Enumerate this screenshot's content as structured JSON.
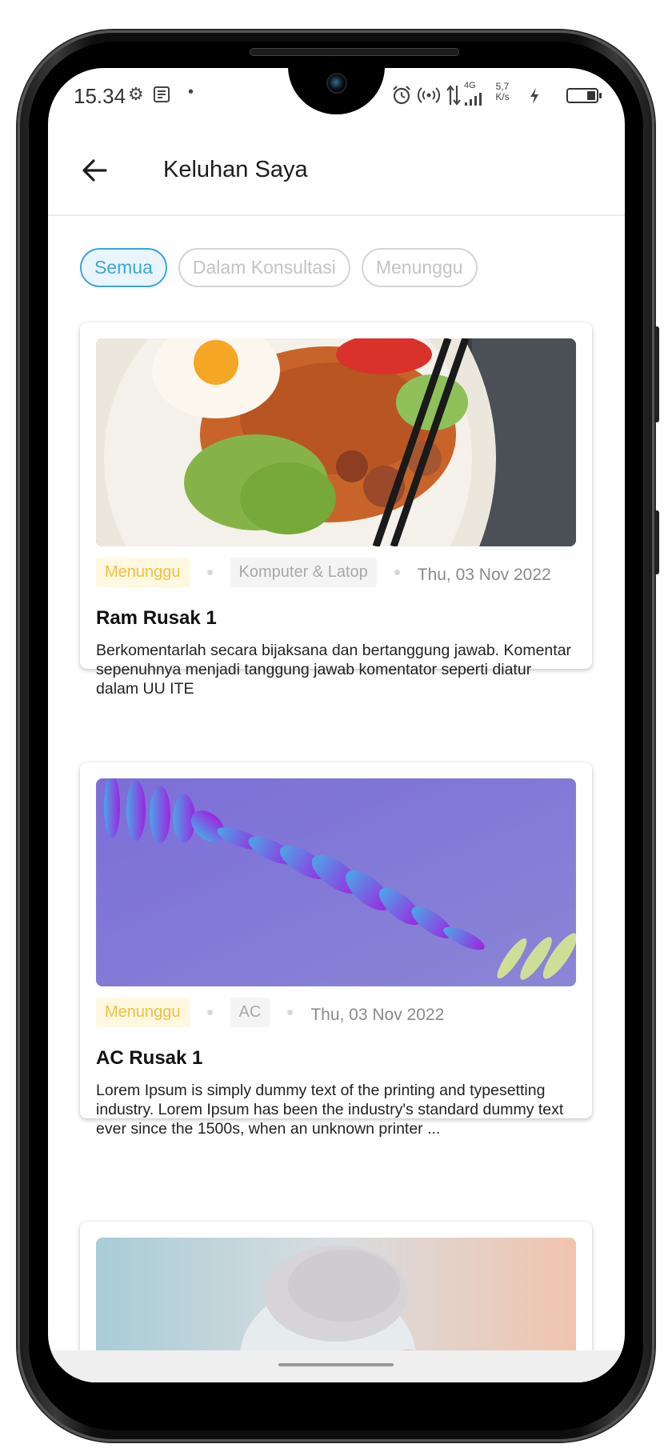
{
  "status_bar": {
    "time": "15.34",
    "network_type": "4G",
    "speed_value": "5,7",
    "speed_unit": "K/s",
    "icons": [
      "settings-gear-icon",
      "news-icon",
      "notification-dot-icon",
      "alarm-icon",
      "hotspot-icon",
      "data-transfer-icon",
      "signal-icon",
      "charging-icon",
      "battery-icon"
    ]
  },
  "app_bar": {
    "back_icon": "arrow-left-icon",
    "title": "Keluhan Saya"
  },
  "filters": [
    {
      "label": "Semua",
      "active": true
    },
    {
      "label": "Dalam Konsultasi",
      "active": false
    },
    {
      "label": "Menunggu",
      "active": false
    }
  ],
  "complaints": [
    {
      "status": "Menunggu",
      "category": "Komputer & Latop",
      "date": "Thu, 03 Nov 2022",
      "title": "Ram Rusak 1",
      "description": "Berkomentarlah secara bijaksana dan bertanggung jawab. Komentar sepenuhnya menjadi tanggung jawab komentator seperti diatur dalam UU ITE"
    },
    {
      "status": "Menunggu",
      "category": "AC",
      "date": "Thu, 03 Nov 2022",
      "title": "AC Rusak 1",
      "description": "Lorem Ipsum is simply dummy text of the printing and typesetting industry. Lorem Ipsum has been the industry's standard dummy text ever since the 1500s, when an unknown printer ..."
    },
    {
      "status": "",
      "category": "",
      "date": "",
      "title": "",
      "description": ""
    }
  ],
  "colors": {
    "accent": "#3ca5dd",
    "status_waiting_text": "#f0c040",
    "status_waiting_bg": "#fff8e1"
  }
}
